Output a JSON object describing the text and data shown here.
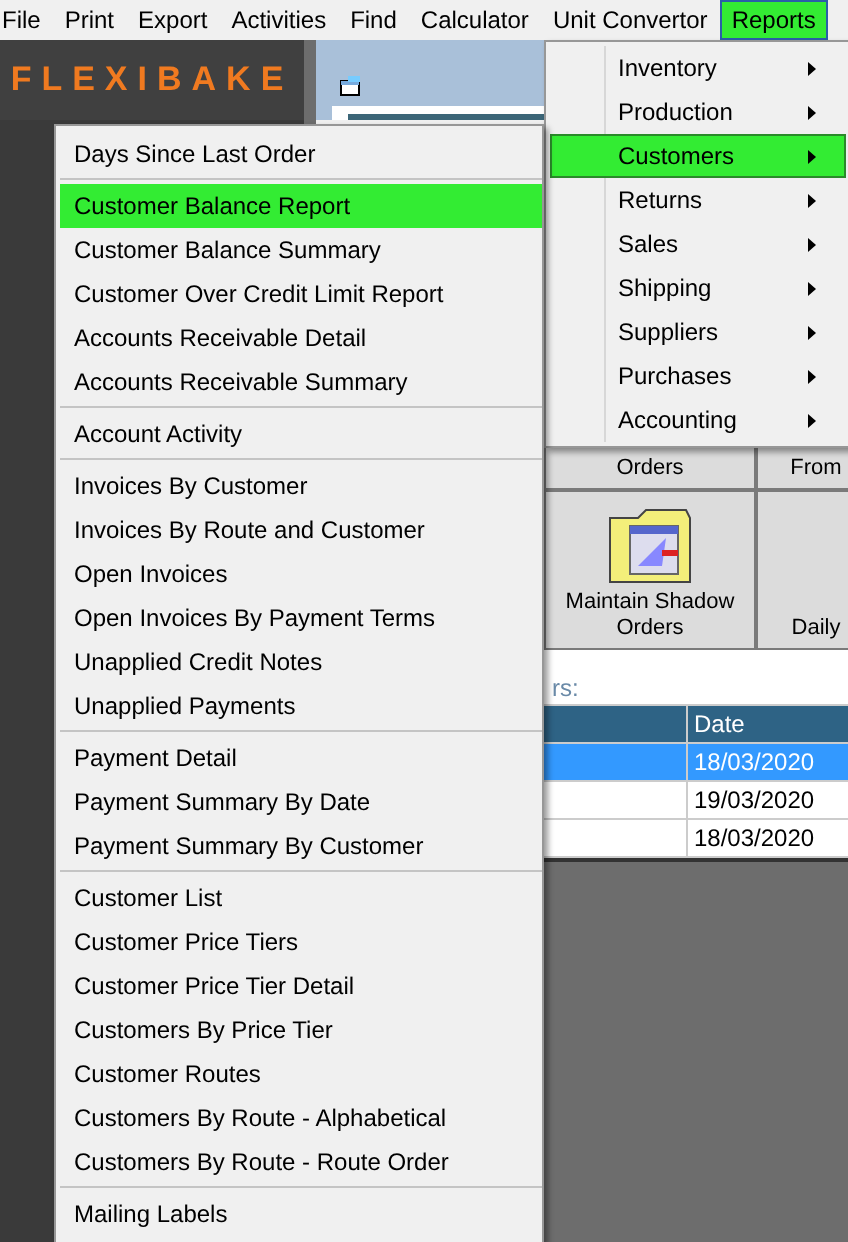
{
  "menubar": [
    {
      "label": "File",
      "selected": false
    },
    {
      "label": "Print",
      "selected": false
    },
    {
      "label": "Export",
      "selected": false
    },
    {
      "label": "Activities",
      "selected": false
    },
    {
      "label": "Find",
      "selected": false
    },
    {
      "label": "Calculator",
      "selected": false
    },
    {
      "label": "Unit Convertor",
      "selected": false
    },
    {
      "label": "Reports",
      "selected": true
    }
  ],
  "logo": "FLEXIBAKE",
  "buttons": [
    {
      "label": "Orders",
      "kind": "text"
    },
    {
      "label": "From",
      "kind": "text"
    },
    {
      "label": "Maintain Shadow Orders",
      "kind": "icon"
    },
    {
      "label": "Daily",
      "kind": "text"
    }
  ],
  "filter_label": "rs:",
  "table": {
    "columns": [
      "",
      "Date"
    ],
    "rows": [
      {
        "cells": [
          "",
          "18/03/2020"
        ],
        "selected": true
      },
      {
        "cells": [
          "",
          "19/03/2020"
        ],
        "selected": false
      },
      {
        "cells": [
          "",
          "18/03/2020"
        ],
        "selected": false
      }
    ]
  },
  "reports_menu": [
    {
      "label": "Inventory",
      "has_submenu": true,
      "selected": false
    },
    {
      "label": "Production",
      "has_submenu": true,
      "selected": false
    },
    {
      "label": "Customers",
      "has_submenu": true,
      "selected": true
    },
    {
      "label": "Returns",
      "has_submenu": true,
      "selected": false
    },
    {
      "label": "Sales",
      "has_submenu": true,
      "selected": false
    },
    {
      "label": "Shipping",
      "has_submenu": true,
      "selected": false
    },
    {
      "label": "Suppliers",
      "has_submenu": true,
      "selected": false
    },
    {
      "label": "Purchases",
      "has_submenu": true,
      "selected": false
    },
    {
      "label": "Accounting",
      "has_submenu": true,
      "selected": false
    }
  ],
  "customers_menu": [
    [
      {
        "label": "Days Since Last Order",
        "selected": false
      }
    ],
    [
      {
        "label": "Customer Balance Report",
        "selected": true
      },
      {
        "label": "Customer Balance Summary",
        "selected": false
      },
      {
        "label": "Customer Over Credit Limit Report",
        "selected": false
      },
      {
        "label": "Accounts Receivable Detail",
        "selected": false
      },
      {
        "label": "Accounts Receivable Summary",
        "selected": false
      }
    ],
    [
      {
        "label": "Account Activity",
        "selected": false
      }
    ],
    [
      {
        "label": "Invoices By Customer",
        "selected": false
      },
      {
        "label": "Invoices By Route and Customer",
        "selected": false
      },
      {
        "label": "Open Invoices",
        "selected": false
      },
      {
        "label": "Open Invoices By Payment Terms",
        "selected": false
      },
      {
        "label": "Unapplied Credit Notes",
        "selected": false
      },
      {
        "label": "Unapplied Payments",
        "selected": false
      }
    ],
    [
      {
        "label": "Payment Detail",
        "selected": false
      },
      {
        "label": "Payment Summary By Date",
        "selected": false
      },
      {
        "label": "Payment Summary By Customer",
        "selected": false
      }
    ],
    [
      {
        "label": "Customer List",
        "selected": false
      },
      {
        "label": "Customer Price Tiers",
        "selected": false
      },
      {
        "label": "Customer Price Tier Detail",
        "selected": false
      },
      {
        "label": "Customers By Price Tier",
        "selected": false
      },
      {
        "label": "Customer Routes",
        "selected": false
      },
      {
        "label": "Customers By Route - Alphabetical",
        "selected": false
      },
      {
        "label": "Customers By Route - Route Order",
        "selected": false
      }
    ],
    [
      {
        "label": "Mailing Labels",
        "selected": false
      }
    ]
  ]
}
